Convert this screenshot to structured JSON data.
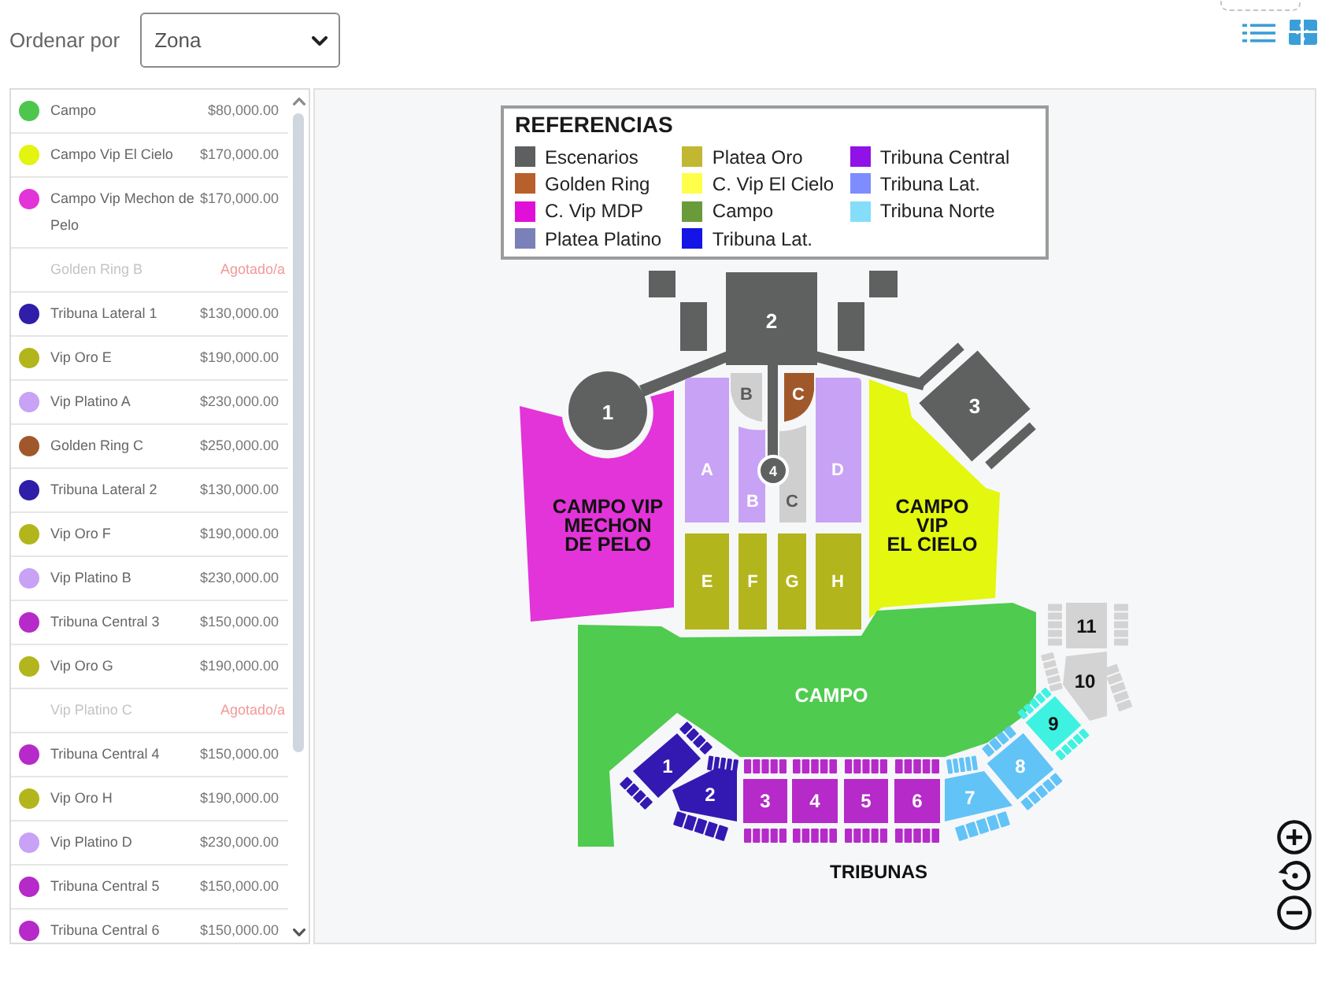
{
  "toolbar": {
    "sort_label": "Ordenar por",
    "sort_value": "Zona"
  },
  "zones_list": [
    {
      "name": "Campo",
      "price": "$80,000.00",
      "color": "#4dc64d",
      "sold_out": false
    },
    {
      "name": "Campo Vip El Cielo",
      "price": "$170,000.00",
      "color": "#e2f40f",
      "sold_out": false
    },
    {
      "name": "Campo Vip Mechon de Pelo",
      "price": "$170,000.00",
      "color": "#e234d8",
      "sold_out": false
    },
    {
      "name": "Golden Ring B",
      "status": "Agotado/a",
      "sold_out": true
    },
    {
      "name": "Tribuna Lateral 1",
      "price": "$130,000.00",
      "color": "#2e1ea8",
      "sold_out": false
    },
    {
      "name": "Vip Oro E",
      "price": "$190,000.00",
      "color": "#b3b51c",
      "sold_out": false
    },
    {
      "name": "Vip Platino A",
      "price": "$230,000.00",
      "color": "#c8a2f5",
      "sold_out": false
    },
    {
      "name": "Golden Ring C",
      "price": "$250,000.00",
      "color": "#a0582b",
      "sold_out": false
    },
    {
      "name": "Tribuna Lateral 2",
      "price": "$130,000.00",
      "color": "#2e1ea8",
      "sold_out": false
    },
    {
      "name": "Vip Oro F",
      "price": "$190,000.00",
      "color": "#b3b51c",
      "sold_out": false
    },
    {
      "name": "Vip Platino B",
      "price": "$230,000.00",
      "color": "#c8a2f5",
      "sold_out": false
    },
    {
      "name": "Tribuna Central 3",
      "price": "$150,000.00",
      "color": "#b52ac9",
      "sold_out": false
    },
    {
      "name": "Vip Oro G",
      "price": "$190,000.00",
      "color": "#b3b51c",
      "sold_out": false
    },
    {
      "name": "Vip Platino C",
      "status": "Agotado/a",
      "sold_out": true
    },
    {
      "name": "Tribuna Central 4",
      "price": "$150,000.00",
      "color": "#b52ac9",
      "sold_out": false
    },
    {
      "name": "Vip Oro H",
      "price": "$190,000.00",
      "color": "#b3b51c",
      "sold_out": false
    },
    {
      "name": "Vip Platino D",
      "price": "$230,000.00",
      "color": "#c8a2f5",
      "sold_out": false
    },
    {
      "name": "Tribuna Central 5",
      "price": "$150,000.00",
      "color": "#b52ac9",
      "sold_out": false
    },
    {
      "name": "Tribuna Central 6",
      "price": "$150,000.00",
      "color": "#b52ac9",
      "sold_out": false
    }
  ],
  "map": {
    "legend": {
      "title": "REFERENCIAS",
      "columns": [
        [
          {
            "label": "Escenarios",
            "color": "#5e5f60"
          },
          {
            "label": "Golden Ring",
            "color": "#b8602b"
          },
          {
            "label": "C. Vip MDP",
            "color": "#e010d8"
          },
          {
            "label": "Platea Platino",
            "color": "#7a80b8"
          }
        ],
        [
          {
            "label": "Platea Oro",
            "color": "#c1b733"
          },
          {
            "label": "C. Vip El Cielo",
            "color": "#ffff4a"
          },
          {
            "label": "Campo",
            "color": "#6a9b3b"
          },
          {
            "label": "Tribuna Lat.",
            "color": "#1414e6"
          }
        ],
        [
          {
            "label": "Tribuna Central",
            "color": "#9012e6"
          },
          {
            "label": "Tribuna Lat.",
            "color": "#7d8cff"
          },
          {
            "label": "Tribuna Norte",
            "color": "#84def9"
          }
        ]
      ]
    },
    "stages": [
      {
        "label": "2"
      },
      {
        "label": "1"
      },
      {
        "label": "3"
      },
      {
        "label": "4"
      }
    ],
    "sections": [
      {
        "label": "A",
        "color": "#c8a2f5"
      },
      {
        "label": "B",
        "color": "#cfcfcf"
      },
      {
        "label": "C",
        "color": "#a0582b"
      },
      {
        "label": "B",
        "color": "#c8a2f5"
      },
      {
        "label": "C",
        "color": "#cfcfcf"
      },
      {
        "label": "D",
        "color": "#c8a2f5"
      },
      {
        "label": "E",
        "color": "#b3b51c"
      },
      {
        "label": "F",
        "color": "#b3b51c"
      },
      {
        "label": "G",
        "color": "#b3b51c"
      },
      {
        "label": "H",
        "color": "#b3b51c"
      }
    ],
    "fields": [
      {
        "label": "CAMPO VIP\nMECHON\nDE PELO",
        "color": "#e234d8"
      },
      {
        "label": "CAMPO\nVIP\nEL CIELO",
        "color": "#e3f70f"
      },
      {
        "label": "CAMPO",
        "color": "#4fcb50"
      }
    ],
    "tribunes": [
      {
        "label": "1",
        "color": "#3319b2"
      },
      {
        "label": "2",
        "color": "#3319b2"
      },
      {
        "label": "3",
        "color": "#b52ac9"
      },
      {
        "label": "4",
        "color": "#b52ac9"
      },
      {
        "label": "5",
        "color": "#b52ac9"
      },
      {
        "label": "6",
        "color": "#b52ac9"
      },
      {
        "label": "7",
        "color": "#62c3f7"
      },
      {
        "label": "8",
        "color": "#62c3f7"
      },
      {
        "label": "9",
        "color": "#3ef2e2"
      },
      {
        "label": "10",
        "color": "#d3d3d3"
      },
      {
        "label": "11",
        "color": "#d3d3d3"
      }
    ],
    "caption": "TRIBUNAS"
  }
}
